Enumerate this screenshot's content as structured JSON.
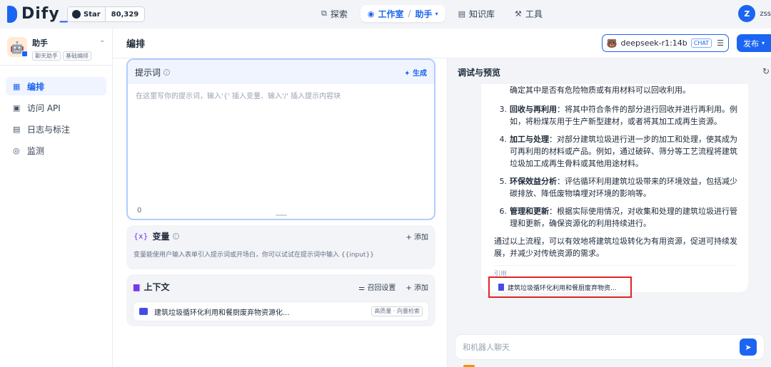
{
  "brand": {
    "name": "Dify",
    "underscore": "_"
  },
  "github": {
    "star_label": "Star",
    "count": "80,329"
  },
  "nav": {
    "explore": "探索",
    "studio": "工作室",
    "studio_sub": "助手",
    "knowledge": "知识库",
    "tools": "工具"
  },
  "user": {
    "initial": "Z",
    "name": "zss"
  },
  "app": {
    "name": "助手",
    "tags": [
      "聊天助手",
      "基础编排"
    ]
  },
  "sidebar": {
    "items": [
      {
        "label": "编排",
        "icon": "layout-icon"
      },
      {
        "label": "访问 API",
        "icon": "terminal-icon"
      },
      {
        "label": "日志与标注",
        "icon": "log-icon"
      },
      {
        "label": "监测",
        "icon": "monitor-icon"
      }
    ]
  },
  "header": {
    "title": "编排",
    "model": "deepseek-r1:14b",
    "model_mode": "CHAT",
    "publish": "发布"
  },
  "prompt": {
    "title": "提示词",
    "generate": "生成",
    "placeholder": "在这里写你的提示词，输入'{' 插入变量、输入'/' 插入提示内容块",
    "count": "0"
  },
  "variables": {
    "title": "变量",
    "add": "添加",
    "description": "变量能使用户输入表单引入提示词或开场白，你可以试试在提示词中输入 {{input}}"
  },
  "context": {
    "title": "上下文",
    "recall": "召回设置",
    "add": "添加",
    "dataset_name": "建筑垃圾循环化利用和餐厨废弃物资源化...",
    "dataset_tag": "高质量 · 向量检索"
  },
  "debug": {
    "title": "调试与预览",
    "lead": "确定其中是否有危险物质或有用材料可以回收利用。",
    "items": [
      {
        "num": "3.",
        "head": "回收与再利用",
        "text": "：将其中符合条件的部分进行回收并进行再利用。例如，将粉煤灰用于生产新型建材，或者将其加工成再生资源。"
      },
      {
        "num": "4.",
        "head": "加工与处理",
        "text": "：对部分建筑垃圾进行进一步的加工和处理，使其成为可再利用的材料或产品。例如，通过破碎、筛分等工艺流程将建筑垃圾加工成再生骨料或其他用途材料。"
      },
      {
        "num": "5.",
        "head": "环保效益分析",
        "text": "：评估循环利用建筑垃圾带来的环境效益，包括减少碳排放、降低废物填埋对环境的影响等。"
      },
      {
        "num": "6.",
        "head": "管理和更新",
        "text": "：根据实际使用情况，对收集和处理的建筑垃圾进行管理和更新，确保资源化的利用持续进行。"
      }
    ],
    "conclusion": "通过以上流程，可以有效地将建筑垃圾转化为有用资源，促进可持续发展，并减少对传统资源的需求。",
    "citation_label": "引用",
    "citation_doc": "建筑垃圾循环化利用和餐厨废弃物资...",
    "input_placeholder": "和机器人聊天"
  },
  "colors": {
    "accent": "#1c64f2",
    "highlight": "#e02424",
    "purple": "#7839ee"
  }
}
